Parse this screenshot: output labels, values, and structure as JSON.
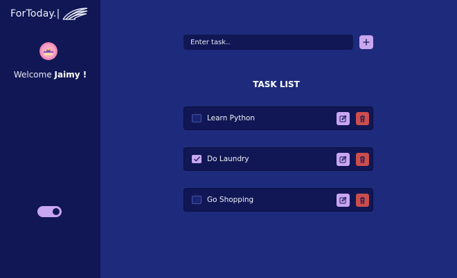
{
  "app": {
    "logo_text": "ForToday.|"
  },
  "sidebar": {
    "welcome_prefix": "Welcome",
    "username": "Jaimy !"
  },
  "main": {
    "input_placeholder": "Enter task..",
    "list_title": "TASK LIST",
    "tasks": [
      {
        "label": "Learn Python",
        "checked": false
      },
      {
        "label": "Do Laundry",
        "checked": true
      },
      {
        "label": "Go Shopping",
        "checked": false
      }
    ]
  },
  "icons": {
    "add": "plus-icon",
    "edit": "edit-icon",
    "delete": "trash-icon",
    "logo": "wing-icon"
  },
  "colors": {
    "sidebar_bg": "#111754",
    "main_bg": "#1e2a7c",
    "accent": "#c9a6f0",
    "danger": "#cc4d4d"
  }
}
